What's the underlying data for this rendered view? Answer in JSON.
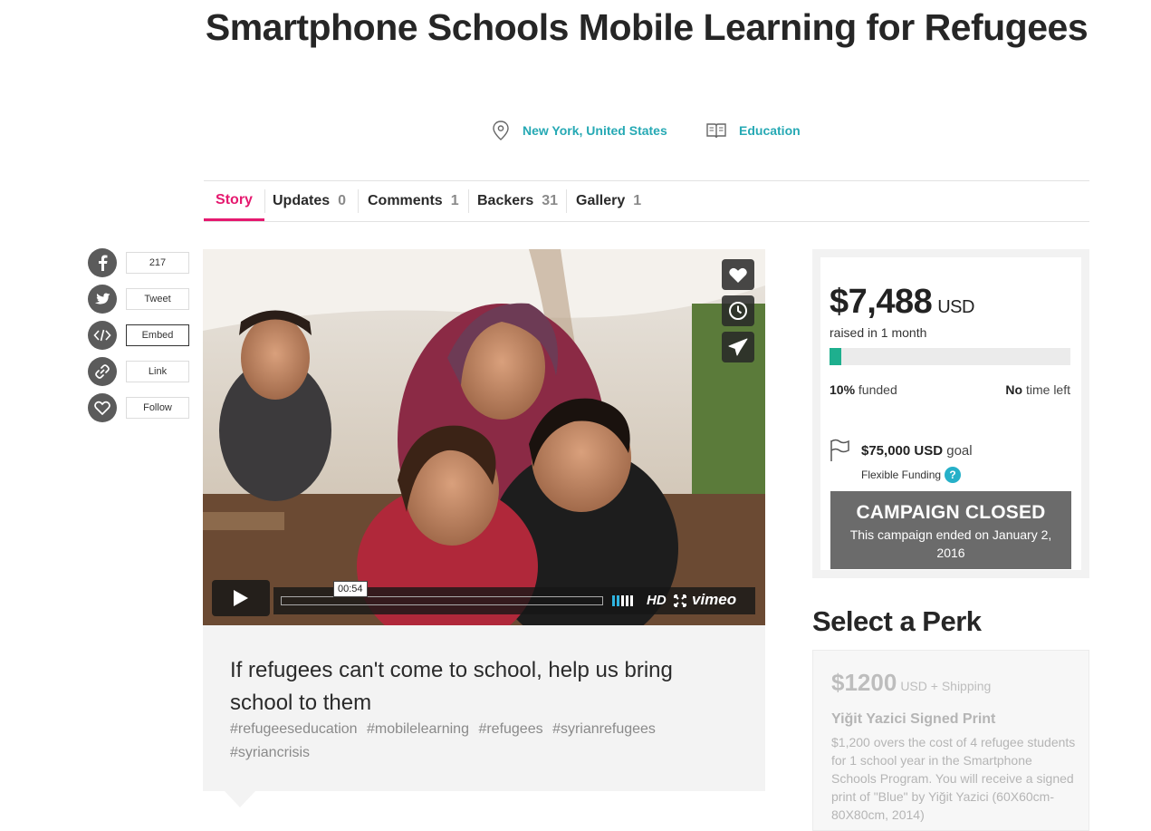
{
  "campaign": {
    "title": "Smartphone Schools Mobile Learning for Refugees",
    "location": "New York, United States",
    "category": "Education"
  },
  "tabs": [
    {
      "label": "Story",
      "count": ""
    },
    {
      "label": "Updates",
      "count": "0"
    },
    {
      "label": "Comments",
      "count": "1"
    },
    {
      "label": "Backers",
      "count": "31"
    },
    {
      "label": "Gallery",
      "count": "1"
    }
  ],
  "share": {
    "facebook_count": "217",
    "tweet": "Tweet",
    "embed": "Embed",
    "link": "Link",
    "follow": "Follow"
  },
  "video": {
    "time": "00:54",
    "hd": "HD",
    "brand": "vimeo"
  },
  "caption": {
    "title": "If refugees can't come to school, help us bring school to them",
    "tags": [
      "#refugeeseducation",
      "#mobilelearning",
      "#refugees",
      "#syrianrefugees",
      "#syriancrisis"
    ]
  },
  "funding": {
    "amount": "$7,488",
    "currency": "USD",
    "raised": "raised in 1 month",
    "percent": 10,
    "funded_pct": "10%",
    "funded_label": "funded",
    "time_strong": "No",
    "time_label": "time left",
    "goal_amount": "$75,000",
    "goal_currency": "USD",
    "goal_label": "goal",
    "flex": "Flexible Funding",
    "closed_title": "CAMPAIGN CLOSED",
    "closed_sub": "This campaign ended on January 2, 2016"
  },
  "perks": {
    "heading": "Select a Perk",
    "items": [
      {
        "price": "$1200",
        "price_suffix": "USD + Shipping",
        "title": "Yiğit Yazici Signed Print",
        "desc": "$1,200 overs the cost of 4 refugee students for 1 school year in the Smartphone Schools Program. You will receive a signed print of \"Blue\" by Yiğit Yazici (60X60cm-80X80cm, 2014)"
      }
    ]
  },
  "colors": {
    "accent": "#e5196f",
    "link": "#26a9b4",
    "progress": "#1eaf8e",
    "closed_bg": "#6b6b6b"
  }
}
